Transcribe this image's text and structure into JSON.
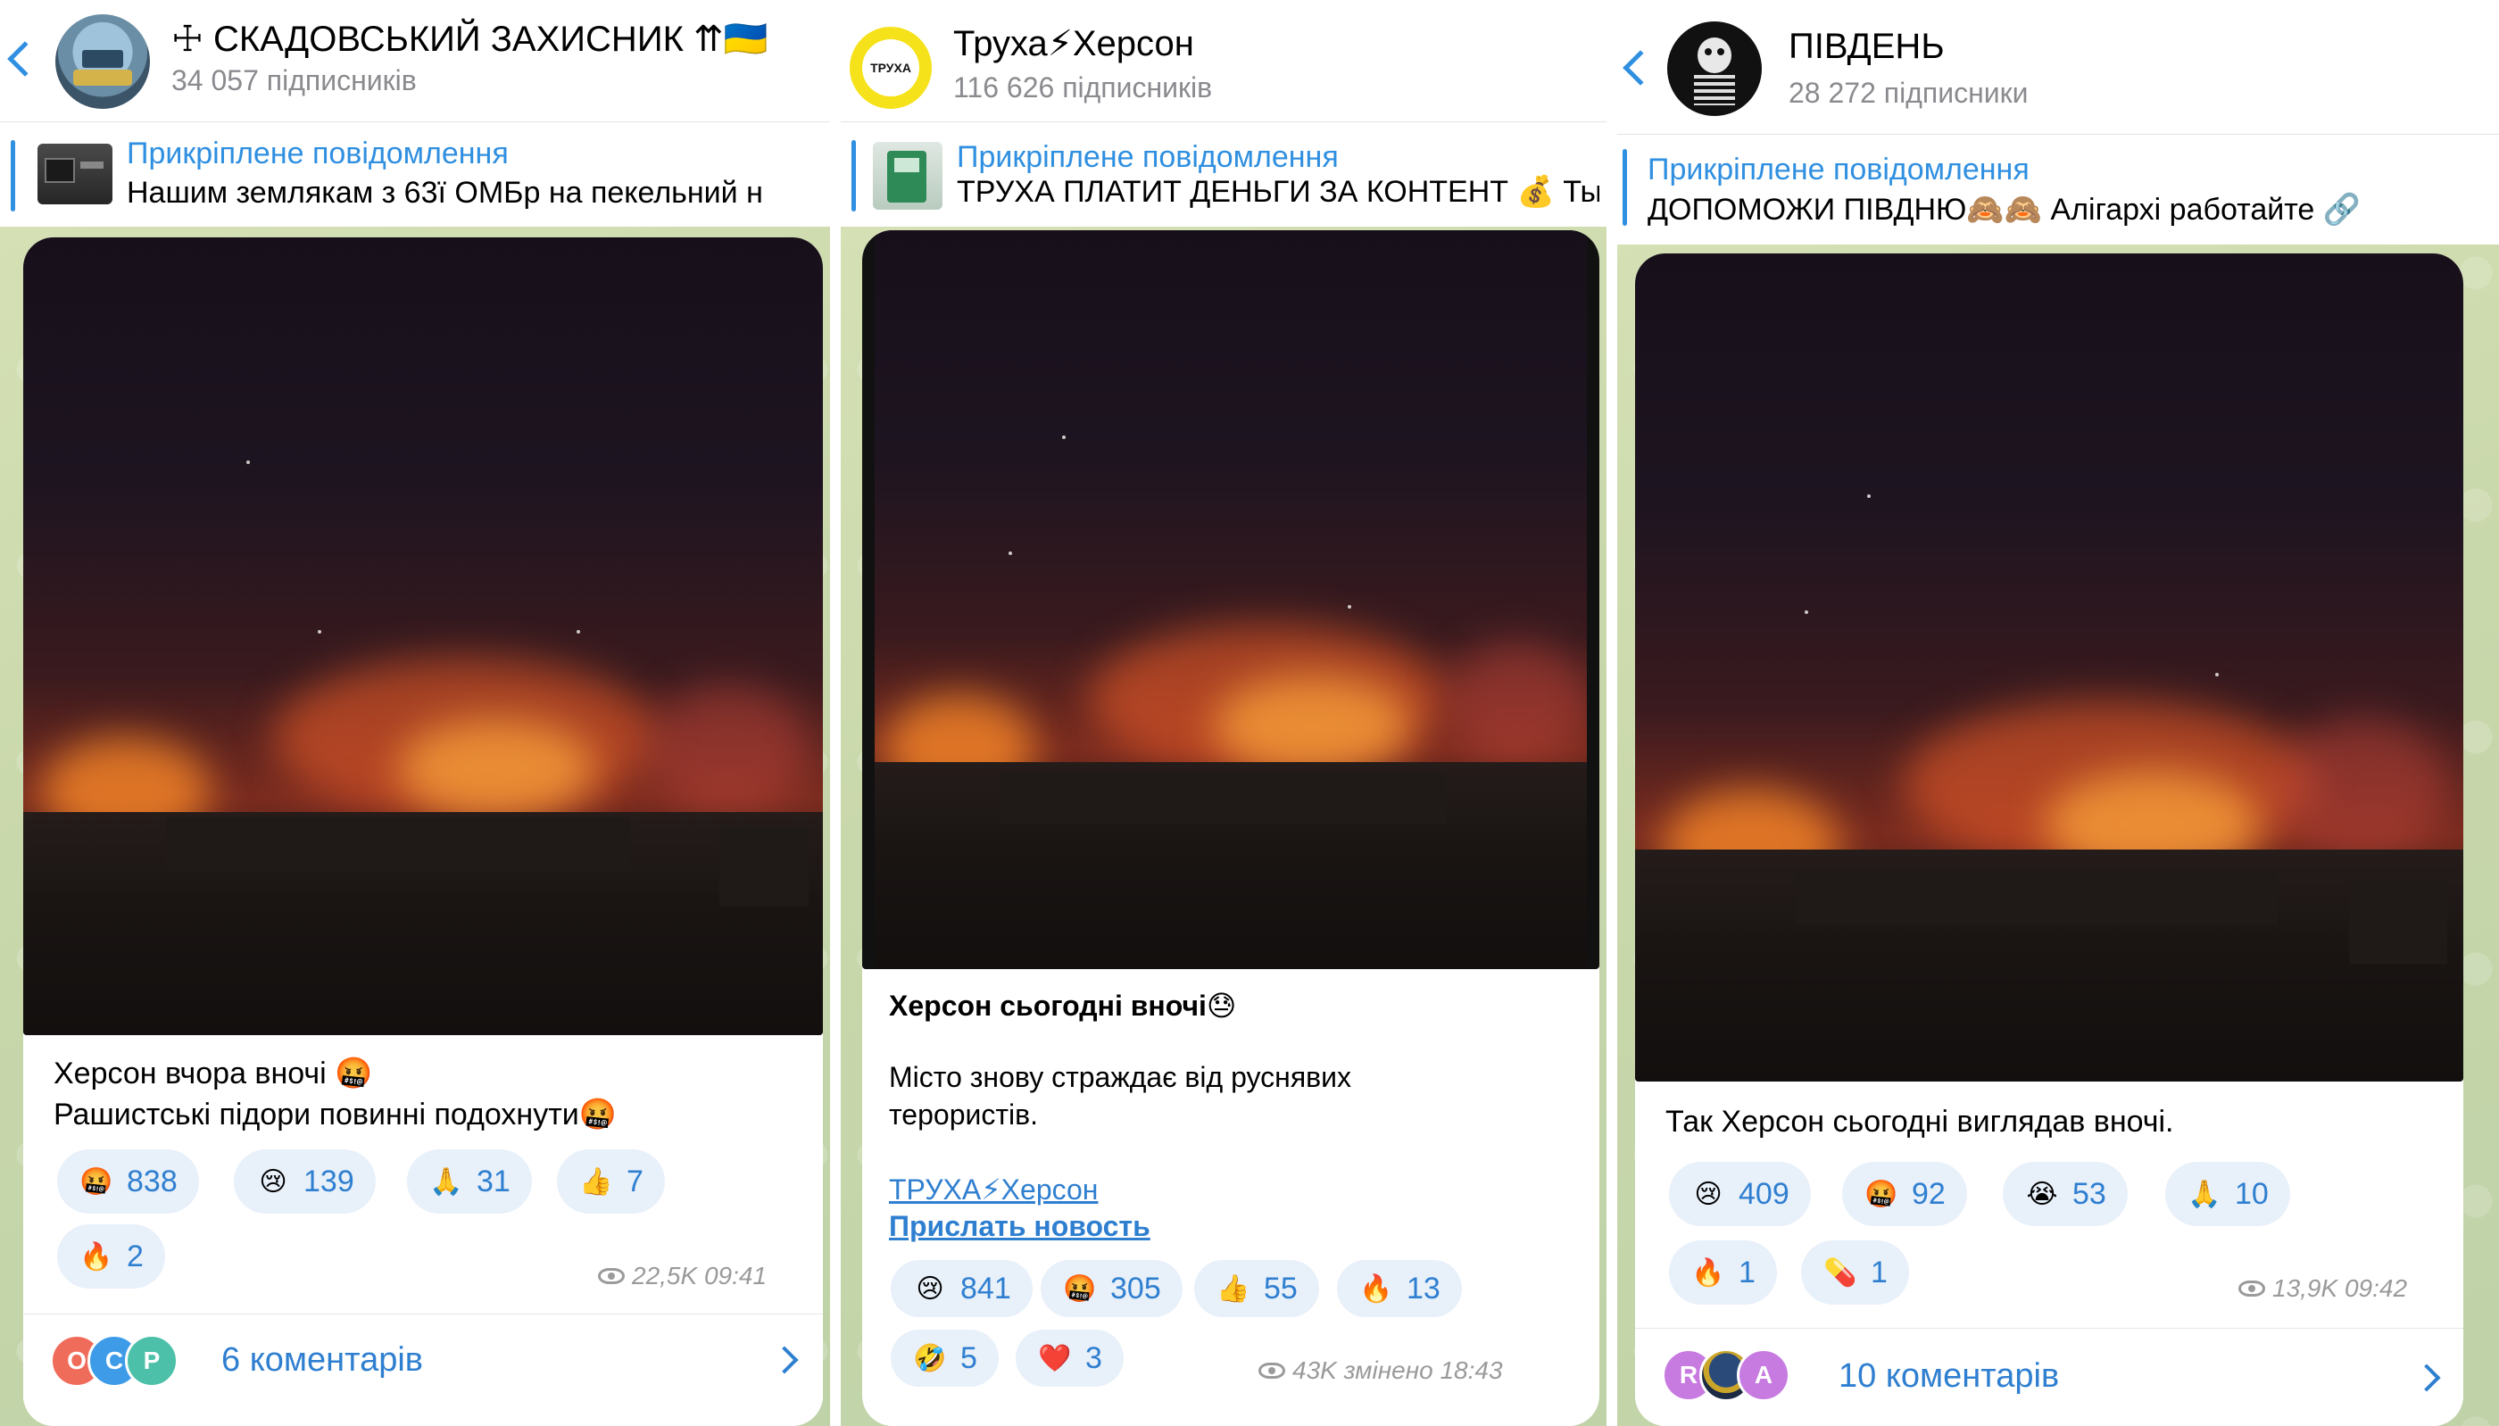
{
  "panels": [
    {
      "title": "☩ СКАДОВСЬКИЙ ЗАХИСНИК ⇈🇺🇦",
      "subscribers": "34 057 підписників",
      "pinned_title": "Прикріплене повідомлення",
      "pinned_text": "Нашим землякам з 63ї ОМБр на пекельний н",
      "message_lines": [
        "Херсон вчора вночі 🤬",
        "Рашистські підори повинні подохнути🤬"
      ],
      "reactions": [
        {
          "emoji": "🤬",
          "count": "838"
        },
        {
          "emoji": "😢",
          "count": "139"
        },
        {
          "emoji": "🙏",
          "count": "31"
        },
        {
          "emoji": "👍",
          "count": "7"
        },
        {
          "emoji": "🔥",
          "count": "2"
        }
      ],
      "views_time": "22,5K 09:41",
      "comment_avatars": [
        "O",
        "C",
        "P"
      ],
      "comments": "6 коментарів"
    },
    {
      "title": "Труха⚡Херсон",
      "avatar_text": "ТРУХА",
      "subscribers": "116 626 підписників",
      "pinned_title": "Прикріплене повідомлення",
      "pinned_text": "ТРУХА ПЛАТИТ ДЕНЬГИ ЗА КОНТЕНТ 💰 Ты",
      "message_title": "Херсон сьогодні вночі😓",
      "message_body": "Місто знову страждає від руснявих терористів.",
      "link_1": "ТРУХА⚡Херсон",
      "link_2": "Прислать новость",
      "reactions": [
        {
          "emoji": "😢",
          "count": "841"
        },
        {
          "emoji": "🤬",
          "count": "305"
        },
        {
          "emoji": "👍",
          "count": "55"
        },
        {
          "emoji": "🔥",
          "count": "13"
        },
        {
          "emoji": "🤣",
          "count": "5"
        },
        {
          "emoji": "❤️",
          "count": "3"
        }
      ],
      "views_time": "43K змінено 18:43"
    },
    {
      "title": "ПІВДЕНЬ",
      "subscribers": "28 272 підписники",
      "pinned_title": "Прикріплене повідомлення",
      "pinned_text": "ДОПОМОЖИ ПІВДНЮ🙈🙈 Алігархі работайте 🔗",
      "message_text": "Так Херсон сьогодні виглядав вночі.",
      "reactions": [
        {
          "emoji": "😢",
          "count": "409"
        },
        {
          "emoji": "🤬",
          "count": "92"
        },
        {
          "emoji": "😭",
          "count": "53"
        },
        {
          "emoji": "🙏",
          "count": "10"
        },
        {
          "emoji": "🔥",
          "count": "1"
        },
        {
          "emoji": "💊",
          "count": "1"
        }
      ],
      "views_time": "13,9K 09:42",
      "comment_avatars": [
        "R",
        "",
        "A"
      ],
      "comments": "10 коментарів"
    }
  ],
  "colors": {
    "accent": "#2f8fe0",
    "link": "#2f7fd0",
    "chat_bg": "#cfdcb0",
    "reaction_bg": "#e8f0fa"
  }
}
